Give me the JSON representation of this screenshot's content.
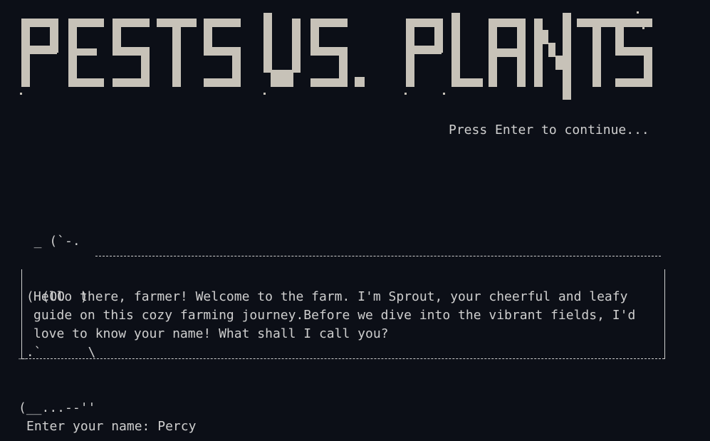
{
  "window": {
    "title_art": "PESTS VS. PLANTS"
  },
  "continue_prompt": "Press Enter to continue...",
  "mascot": {
    "lines": [
      "  _ (`-.",
      " ( (OO  )",
      "_.`      \\",
      "(__...--''"
    ]
  },
  "dialog": {
    "lines": [
      "Hello there, farmer! Welcome to the farm. I'm Sprout, your cheerful and leafy",
      "guide on this cozy farming journey.Before we dive into the vibrant fields, I'd",
      "love to know your name! What shall I call you?"
    ]
  },
  "input": {
    "label": "Enter your name: ",
    "value": "Percy"
  },
  "colors": {
    "background": "#0c0f17",
    "foreground": "#cfcfcf",
    "banner": "#c7c2b8"
  }
}
